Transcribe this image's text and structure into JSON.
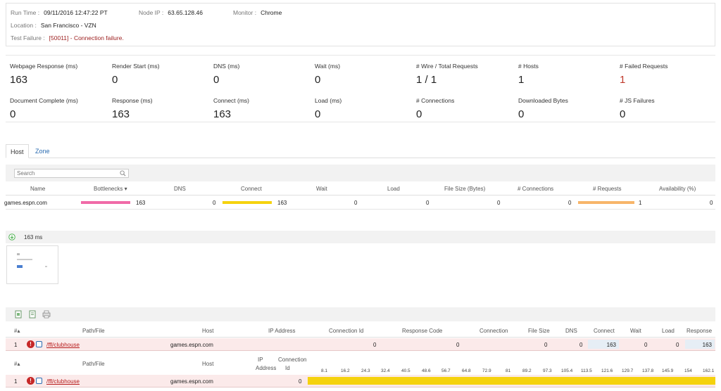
{
  "info": {
    "run_time_label": "Run Time :",
    "run_time": "09/11/2016 12:47:22 PT",
    "node_ip_label": "Node IP :",
    "node_ip": "63.65.128.46",
    "monitor_label": "Monitor :",
    "monitor": "Chrome",
    "location_label": "Location :",
    "location": "San Francisco - VZN",
    "test_failure_label": "Test Failure :",
    "test_failure": "[50011] - Connection failure."
  },
  "metrics": [
    {
      "label": "Webpage Response (ms)",
      "value": "163"
    },
    {
      "label": "Render Start (ms)",
      "value": "0"
    },
    {
      "label": "DNS (ms)",
      "value": "0"
    },
    {
      "label": "Wait (ms)",
      "value": "0"
    },
    {
      "label": "# Wire / Total Requests",
      "value": "1 / 1"
    },
    {
      "label": "# Hosts",
      "value": "1"
    },
    {
      "label": "# Failed Requests",
      "value": "1"
    },
    {
      "label": "Document Complete (ms)",
      "value": "0"
    },
    {
      "label": "Response (ms)",
      "value": "163"
    },
    {
      "label": "Connect (ms)",
      "value": "163"
    },
    {
      "label": "Load (ms)",
      "value": "0"
    },
    {
      "label": "# Connections",
      "value": "0"
    },
    {
      "label": "Downloaded Bytes",
      "value": "0"
    },
    {
      "label": "# JS Failures",
      "value": "0"
    }
  ],
  "tabs": [
    "Host",
    "Zone"
  ],
  "search": {
    "placeholder": "Search"
  },
  "host_table": {
    "headers": [
      "Name",
      "Bottlenecks ▾",
      "DNS",
      "Connect",
      "Wait",
      "Load",
      "File Size (Bytes)",
      "# Connections",
      "# Requests",
      "Availability (%)"
    ],
    "row": {
      "name": "games.espn.com",
      "bottlenecks": "163",
      "dns": "0",
      "connect": "163",
      "wait": "0",
      "load": "0",
      "file_size": "0",
      "connections": "0",
      "requests": "1",
      "availability": "0"
    }
  },
  "filmstrip": {
    "time": "163 ms"
  },
  "waterfall": {
    "headers": [
      "#▴",
      "Path/File",
      "Host",
      "IP Address",
      "Connection Id",
      "Response Code",
      "Connection",
      "File Size",
      "DNS",
      "Connect",
      "Wait",
      "Load",
      "Response"
    ],
    "row": {
      "num": "1",
      "path": "/ffl/clubhouse",
      "host": "games.espn.com",
      "connection_id": "0",
      "response_code": "0",
      "file_size": "0",
      "dns": "0",
      "connect": "163",
      "wait": "0",
      "load": "0",
      "response": "163"
    },
    "headers2": {
      "num": "#▴",
      "path": "Path/File",
      "host": "Host",
      "ip1": "IP",
      "ip2": "Address",
      "cid1": "Connection",
      "cid2": "Id"
    },
    "ticks": [
      "8.1",
      "16.2",
      "24.3",
      "32.4",
      "40.5",
      "48.6",
      "56.7",
      "64.8",
      "72.9",
      "81",
      "89.2",
      "97.3",
      "105.4",
      "113.5",
      "121.6",
      "129.7",
      "137.8",
      "145.9",
      "154",
      "162.1"
    ],
    "row2": {
      "num": "1",
      "path": "/ffl/clubhouse",
      "host": "games.espn.com",
      "connection_id": "0"
    }
  },
  "colors": {
    "bottleneck_bar": "#f06ba8",
    "connect_bar": "#f5d20e",
    "requests_bar": "#f7b56a",
    "failure": "#9b1c1c"
  }
}
